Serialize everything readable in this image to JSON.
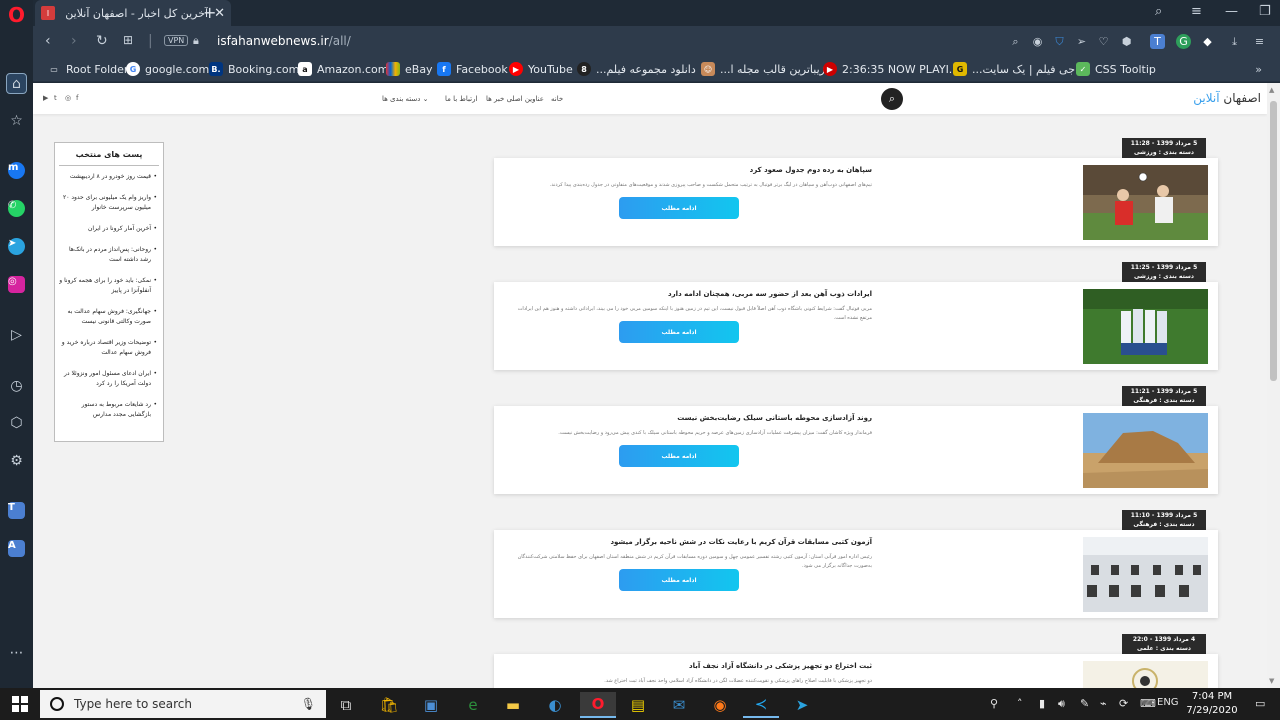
{
  "browser": {
    "tab_title": "آخرین کل اخبار - اصفهان آنلاین",
    "tab_favicon": "ا",
    "url_host": "isfahanwebnews.ir",
    "url_path": "/all/",
    "vpn_label": "VPN"
  },
  "bookmarks": [
    {
      "label": "Root Folder",
      "icon": "folder-icon"
    },
    {
      "label": "google.com",
      "icon": "google-icon"
    },
    {
      "label": "Booking.com",
      "icon": "booking-icon"
    },
    {
      "label": "Amazon.com",
      "icon": "amazon-icon"
    },
    {
      "label": "eBay",
      "icon": "ebay-icon"
    },
    {
      "label": "Facebook",
      "icon": "facebook-icon"
    },
    {
      "label": "YouTube",
      "icon": "youtube-icon"
    },
    {
      "label": "دانلود مجموعه فیلم...",
      "icon": "film-icon"
    },
    {
      "label": "زیباترین قالب مجله ا...",
      "icon": "theme-icon"
    },
    {
      "label": "2:36:35 NOW PLAYI...",
      "icon": "play-icon"
    },
    {
      "label": "جی فیلم | یک سایت...",
      "icon": "gfilm-icon"
    },
    {
      "label": "CSS Tooltip",
      "icon": "css-icon"
    }
  ],
  "site": {
    "logo_main": "اصفهان",
    "logo_accent": "آنلاین",
    "nav": {
      "home": "خانه",
      "headlines": "عناوین اصلی خبر ها",
      "contact": "ارتباط با ما",
      "categories": "دسته بندی ها"
    }
  },
  "featured": {
    "title": "پست های منتخب",
    "items": [
      "قیمت روز خودرو در ۸ اردیبهشت",
      "واریز وام یک میلیونی برای حدود ۲۰ میلیون سرپرست خانوار",
      "آخرین آمار کرونا در ایران",
      "روحانی: پس‌انداز مردم در بانک‌ها رشد داشته است",
      "نمکی: باید خود را برای هجمه کرونا و آنفلوآنزا در پاییز",
      "جهانگیری: فروش سهام عدالت به صورت وکالتی قانونی نیست",
      "توضیحات وزیر اقتصاد درباره خرید و فروش سهام عدالت",
      "ایران ادعای مسئول امور ونزوئلا در دولت آمریکا را رد کرد",
      "رد شایعات مربوط به دستور بازگشایی مجدد مدارس"
    ]
  },
  "read_more_label": "ادامه مطلب",
  "posts": [
    {
      "date": "5 مرداد 1399 - 11:28",
      "category": "دسته بندی : ورزشی",
      "title": "سپاهان به رده دوم جدول صعود کرد",
      "excerpt": "تیم‌های اصفهانی ذوب‌آهن و سپاهان در لیگ برتر فوتبال به ترتیب متحمل شکست و صاحب پیروزی شدند و موقعیت‌های متفاوتی در جدول رده‌بندی پیدا کردند.",
      "image": "soccer-match-image"
    },
    {
      "date": "5 مرداد 1399 - 11:25",
      "category": "دسته بندی : ورزشی",
      "title": "ایرادات ذوب آهن بعد از حضور سه مربی، همچنان ادامه دارد",
      "excerpt": "مربی فوتبال گفت: شرایط کنونی باشگاه ذوب آهن اصلاً قابل قبول نیست، این تیم در زمین هنوز با اینکه سومین مربی خود را می بیند، ایراداتی داشته و هنوز هم این ایرادات مرتفع نشده است.",
      "image": "team-huddle-image"
    },
    {
      "date": "5 مرداد 1399 - 11:21",
      "category": "دسته بندی : فرهنگی",
      "title": "روند آزادسازی محوطه باستانی سیلک رضایت‌بخش نیست",
      "excerpt": "فرماندار ویژه کاشان گفت: میزان پیشرفت عملیات آزادسازی زمین‌های عرصه و حریم محوطه باستانی سیلک با کندی پیش می‌رود و رضایت‌بخش نیست.",
      "image": "ancient-site-image"
    },
    {
      "date": "5 مرداد 1399 - 11:10",
      "category": "دسته بندی : فرهنگی",
      "title": "آزمون کتبی مسابقات قرآن کریم با رعایت نکات در شش ناحیه برگزار میشود",
      "excerpt": "رئیس اداره امور قرآنی استان: آزمون کتبی رشته تفسیر عمومی چهل و سومین دوره مسابقات قرآن کریم در شش منطقه استان اصفهان برای حفظ سلامتی شرکت‌کنندگان به‌صورت جداگانه برگزار می شود.",
      "image": "exam-hall-image"
    },
    {
      "date": "4 مرداد 1399 - 22:0",
      "category": "دسته بندی : علمی",
      "title": "ثبت اختراع دو تجهیز پزشکی در دانشگاه آزاد نجف آباد",
      "excerpt": "دو تجهیز پزشکی با قابلیت اصلاح راهای پزشکی و تقویت‌کننده عضلات لگن در دانشگاه آزاد اسلامی واحد نجف آباد ثبت اختراع شد.",
      "image": "medical-device-image"
    }
  ],
  "taskbar": {
    "search_placeholder": "Type here to search",
    "lang": "ENG",
    "time": "7:04 PM",
    "date": "7/29/2020"
  },
  "colors": {
    "accent": "#3aa0ec",
    "button_gradient_start": "#2d9cf0",
    "button_gradient_end": "#12c6ef",
    "meta_badge": "#2b2b2b"
  }
}
